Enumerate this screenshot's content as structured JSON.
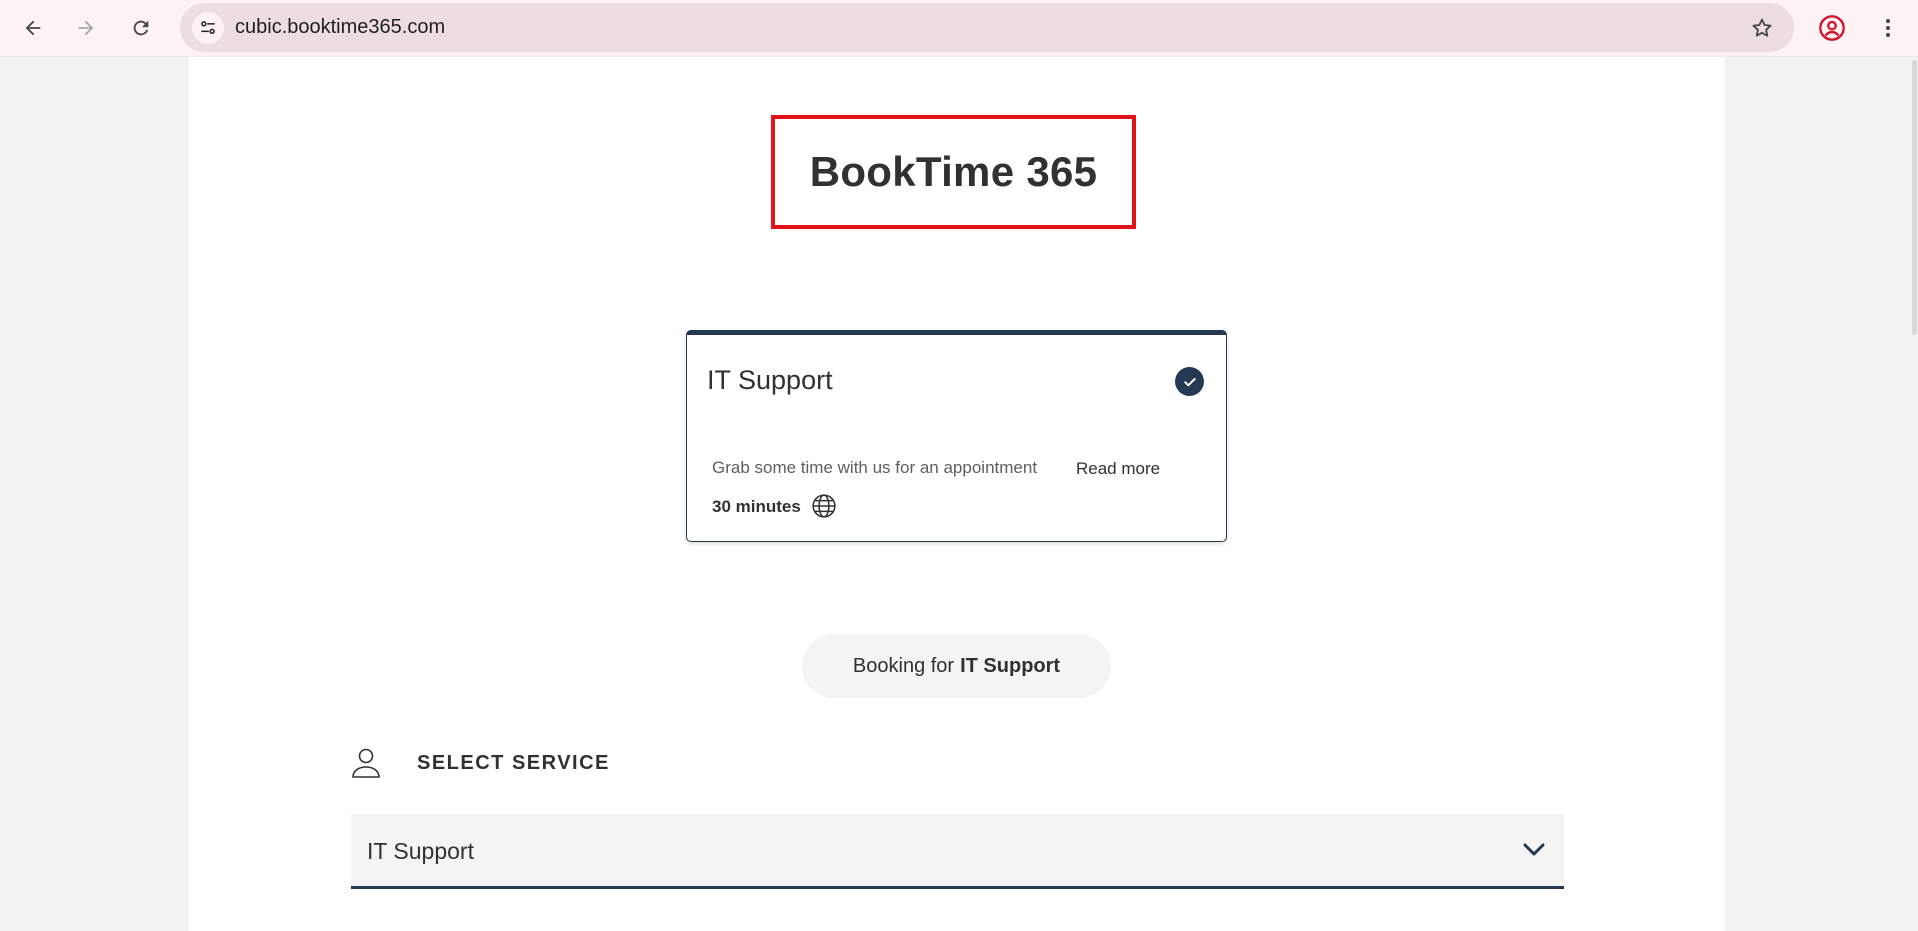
{
  "browser": {
    "url": "cubic.booktime365.com",
    "icons": {
      "back": "back-arrow-icon",
      "forward": "forward-arrow-icon",
      "reload": "reload-icon",
      "site_info": "tune-icon",
      "bookmark": "star-icon",
      "profile": "account-icon",
      "menu": "kebab-menu-icon"
    },
    "profile_color": "#d3132a"
  },
  "page": {
    "brand_title": "BookTime 365",
    "highlight_color": "#e3121a",
    "service_card": {
      "title": "IT Support",
      "selected": true,
      "description": "Grab some time with us for an appointment",
      "read_more": "Read more",
      "duration": "30 minutes",
      "accent_color": "#243a52"
    },
    "booking": {
      "prefix": "Booking for",
      "service": "IT Support"
    },
    "select_service": {
      "label": "SELECT SERVICE",
      "selected_value": "IT Support"
    }
  }
}
